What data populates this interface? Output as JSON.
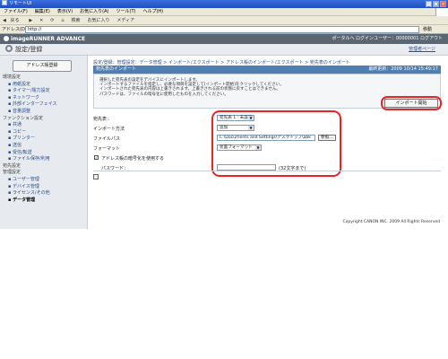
{
  "window": {
    "title": "リモートUI",
    "controls": [
      "_",
      "□",
      "×"
    ]
  },
  "menu": [
    "ファイル(F)",
    "編集(E)",
    "表示(V)",
    "お気に入り(A)",
    "ツール(T)",
    "ヘルプ(H)"
  ],
  "toolbar": {
    "back": "戻る",
    "items": [
      "検索",
      "お気に入り",
      "メディア"
    ]
  },
  "address": {
    "label": "アドレス(D)",
    "value": "http://",
    "go": "移動"
  },
  "page_header": {
    "brand": "imageRUNNER ADVANCE",
    "right": "ポータルへ  ログインユーザー：00000001  ログアウト"
  },
  "sub_header": {
    "title": "設定/登録",
    "manager": "管理者ページ"
  },
  "sidebar": {
    "addr_button": "アドレス帳登録",
    "items": [
      {
        "label": "環境設定",
        "type": "sec"
      },
      {
        "label": "用紙設定",
        "type": "it"
      },
      {
        "label": "タイマー/電力設定",
        "type": "it"
      },
      {
        "label": "ネットワーク",
        "type": "it"
      },
      {
        "label": "外部インターフェイス",
        "type": "it"
      },
      {
        "label": "音量調整",
        "type": "it"
      },
      {
        "label": "ファンクション設定",
        "type": "sec"
      },
      {
        "label": "共通",
        "type": "it"
      },
      {
        "label": "コピー",
        "type": "it"
      },
      {
        "label": "プリンター",
        "type": "it"
      },
      {
        "label": "送信",
        "type": "it"
      },
      {
        "label": "受信/転送",
        "type": "it"
      },
      {
        "label": "ファイル保存/利用",
        "type": "it"
      },
      {
        "label": "宛先設定",
        "type": "sec"
      },
      {
        "label": "管理設定",
        "type": "sec"
      },
      {
        "label": "ユーザー管理",
        "type": "it"
      },
      {
        "label": "デバイス管理",
        "type": "it"
      },
      {
        "label": "ライセンス/その他",
        "type": "it"
      },
      {
        "label": "データ管理",
        "type": "it active"
      }
    ]
  },
  "breadcrumb": "設定/登録：管理設定：データ管理 > インポート/エクスポート > アドレス帳のインポート/エクスポート > 宛先表のインポート",
  "panel": {
    "title": "宛先表のインポート",
    "datetime": "最終更新：2009 10/14 15:49:17",
    "description": [
      "選択した宛先表の設定をデバイスにインポートします。",
      "インポートするファイルを指定し、必要な項目を設定して[インポート開始]をクリックしてください。",
      "インポートされた宛先表の内容は上書きされます。上書きされる前の状態に戻すことはできません。",
      "パスワードは、ファイルの暗号化に使用したものを入力してください。"
    ],
    "start_button": "インポート開始"
  },
  "form": {
    "addr_list_label": "宛先表：",
    "addr_list_value": "宛先表 1 : 未設定",
    "method_label": "インポート方法",
    "method_value": "追加",
    "path_label": "ファイルパス",
    "path_value": "C:\\Documents and Settings\\デスクトップ\\abk",
    "browse_button": "参照...",
    "format_label": "フォーマット",
    "format_value": "装置フォーマット",
    "encrypt_label": "アドレス帳の暗号化を使用する",
    "password_label": "パスワード：",
    "password_hint": "(32文字まで)"
  },
  "footer": {
    "copyright": "Copyright CANON INC. 2009 All Rights Reserved"
  }
}
